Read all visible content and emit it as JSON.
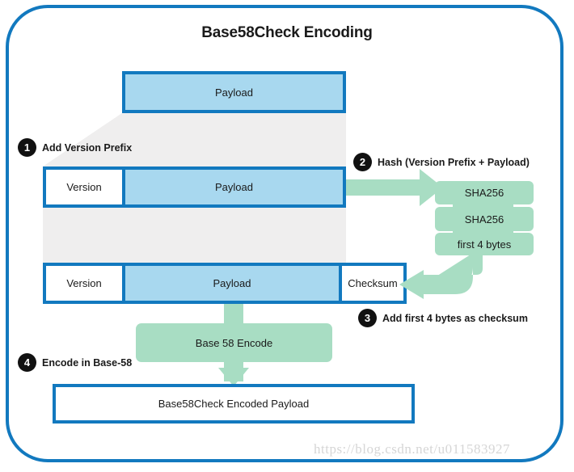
{
  "diagram": {
    "title": "Base58Check Encoding",
    "watermark": "https://blog.csdn.net/u011583927",
    "colors": {
      "frame_border": "#1279bf",
      "box_border": "#1279bf",
      "payload_fill": "#a8d8ef",
      "hash_fill": "#a8ddc3",
      "connector_fill": "#efeeee",
      "badge_fill": "#111111",
      "text": "#1a1a1a",
      "watermark": "#d6d6d6"
    },
    "top_row": {
      "payload_label": "Payload"
    },
    "middle_row": {
      "version_label": "Version",
      "payload_label": "Payload"
    },
    "bottom_row": {
      "version_label": "Version",
      "payload_label": "Payload",
      "checksum_label": "Checksum"
    },
    "hash_chain": [
      {
        "label": "SHA256"
      },
      {
        "label": "SHA256"
      },
      {
        "label": "first 4 bytes"
      }
    ],
    "encode_box": {
      "label": "Base 58 Encode"
    },
    "output_box": {
      "label": "Base58Check Encoded Payload"
    },
    "steps": [
      {
        "number": "1",
        "label": "Add Version Prefix"
      },
      {
        "number": "2",
        "label": "Hash (Version Prefix + Payload)"
      },
      {
        "number": "3",
        "label": "Add first 4 bytes as checksum"
      },
      {
        "number": "4",
        "label": "Encode in Base-58"
      }
    ]
  }
}
